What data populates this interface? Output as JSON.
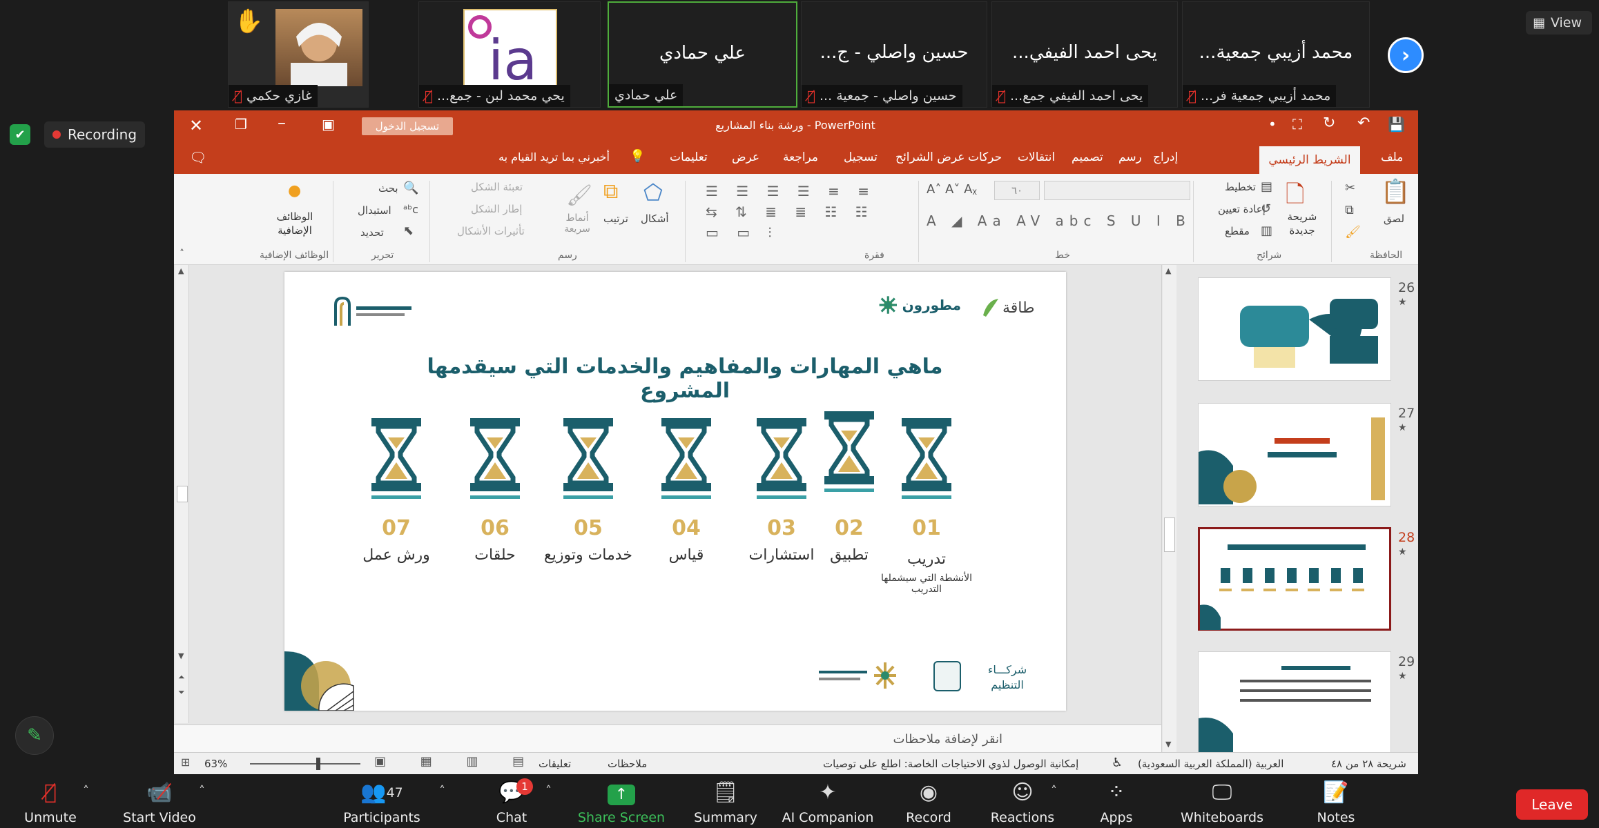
{
  "zoom_meeting": {
    "view_label": "View",
    "recording_label": "Recording",
    "participants": [
      {
        "name": "...محمد أزيبي جمعية",
        "caption": "...محمد أزيبي جمعية فر"
      },
      {
        "name": "...يحى احمد الفيفي",
        "caption": "...يحى احمد الفيفي جمع"
      },
      {
        "name": "...حسين واصلي - ج",
        "caption": "... حسين واصلي - جمعية"
      },
      {
        "name": "علي حمادي",
        "caption": "علي حمادي"
      },
      {
        "name": "",
        "caption": "...يحي محمد لبن - جمع"
      },
      {
        "name": "",
        "caption": "غازي حكمي"
      }
    ],
    "logo_text": "ia",
    "toolbar": {
      "unmute": "Unmute",
      "start_video": "Start Video",
      "participants": "Participants",
      "participants_count": "47",
      "chat": "Chat",
      "chat_badge": "1",
      "share_screen": "Share Screen",
      "summary": "Summary",
      "ai_companion": "AI Companion",
      "record": "Record",
      "reactions": "Reactions",
      "apps": "Apps",
      "whiteboards": "Whiteboards",
      "notes": "Notes",
      "leave": "Leave"
    }
  },
  "powerpoint": {
    "title": "ورشة بناء المشاريع  -  PowerPoint",
    "signin_button": "تسجيل الدخول",
    "tabs": [
      "ملف",
      "الشريط الرئيسي",
      "إدراج",
      "رسم",
      "تصميم",
      "انتقالات",
      "حركات",
      "عرض الشرائح",
      "تسجيل",
      "مراجعة",
      "عرض",
      "تعليمات"
    ],
    "tell_me": "أخبرني بما تريد القيام به",
    "ribbon": {
      "paste": "لصق",
      "clipboard_group": "الحافظة",
      "new_slide": "شريحة جديدة",
      "layout": "تخطيط",
      "reset": "إعادة تعيين",
      "section": "مقطع",
      "slides_group": "شرائح",
      "font_group": "خط",
      "paragraph_group": "فقرة",
      "shapes": "أشكال",
      "arrange": "ترتيب",
      "quick_styles": "أنماط سريعة",
      "shape_fill": "تعبئة الشكل",
      "shape_outline": "إطار الشكل",
      "shape_effects": "تأثيرات الأشكال",
      "drawing_group": "رسم",
      "find": "بحث",
      "replace": "استبدال",
      "select": "تحديد",
      "editing_group": "تحرير",
      "addins": "الوظائف الإضافية",
      "addins_group": "الوظائف الإضافية",
      "font_size": "٦٠"
    },
    "slide": {
      "title": "ماهي المهارات والمفاهيم والخدمات التي سيقدمها المشروع",
      "logo_right": "طاقة",
      "logo_mid": "مطورون",
      "items": [
        {
          "num": "01",
          "label": "تدريب",
          "sub": "الأنشطة التي سيشملها التدريب"
        },
        {
          "num": "02",
          "label": "تطبيق",
          "sub": ""
        },
        {
          "num": "03",
          "label": "استشارات",
          "sub": ""
        },
        {
          "num": "04",
          "label": "قياس",
          "sub": ""
        },
        {
          "num": "05",
          "label": "خدمات وتوزيع",
          "sub": ""
        },
        {
          "num": "06",
          "label": "حلقات",
          "sub": ""
        },
        {
          "num": "07",
          "label": "ورش عمل",
          "sub": ""
        }
      ],
      "partners_label": "شركـــاء التنظيم"
    },
    "thumbnails": [
      {
        "num": "26",
        "star": "★"
      },
      {
        "num": "27",
        "star": "★"
      },
      {
        "num": "28",
        "star": "★"
      },
      {
        "num": "29",
        "star": "★"
      }
    ],
    "notes_placeholder": "انقر لإضافة ملاحظات",
    "status": {
      "slide_info": "شريحة ٢٨ من ٤٨",
      "language": "العربية (المملكة العربية السعودية)",
      "accessibility": "إمكانية الوصول لذوي الاحتياجات الخاصة: اطلع على توصيات",
      "notes": "ملاحظات",
      "comments": "تعليقات",
      "zoom": "63%"
    }
  }
}
